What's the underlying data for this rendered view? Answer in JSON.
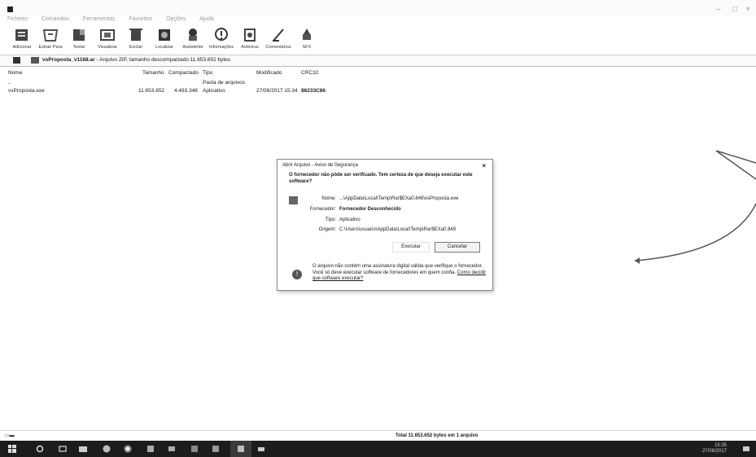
{
  "window": {
    "menu": [
      "Ficheiro",
      "Comandos",
      "Ferramentas",
      "Favoritos",
      "Opções",
      "Ajuda"
    ]
  },
  "toolbar": {
    "buttons": [
      {
        "label": "Adicionar",
        "icon": "add-archive-icon"
      },
      {
        "label": "Extrair Para",
        "icon": "extract-icon"
      },
      {
        "label": "Testar",
        "icon": "test-icon"
      },
      {
        "label": "Visualizar",
        "icon": "view-icon"
      },
      {
        "label": "Excluir",
        "icon": "delete-icon"
      },
      {
        "label": "Localizar",
        "icon": "find-icon"
      },
      {
        "label": "Assistente",
        "icon": "wizard-icon"
      },
      {
        "label": "Informações",
        "icon": "info-icon"
      },
      {
        "label": "Antivírus",
        "icon": "virus-scan-icon"
      },
      {
        "label": "Comentários",
        "icon": "comment-icon"
      },
      {
        "label": "SFX",
        "icon": "sfx-icon"
      }
    ]
  },
  "address": {
    "archive_name": "vsProposta_v1168.ar",
    "info": "- Arquivo ZIP, tamanho descompactado 11.653.652 bytes"
  },
  "columns": {
    "name": "Nome",
    "size": "Tamanho",
    "packed": "Compactado",
    "type": "Tipo",
    "modified": "Modificado",
    "crc": "CRC32"
  },
  "parent_row": {
    "name": "..",
    "type": "Pasta de arquivos"
  },
  "file_row": {
    "name": "vsProposta.exe",
    "size": "11.653.652",
    "packed": "4.493.348",
    "type": "Aplicativo",
    "modified": "27/08/2017 15:34",
    "crc": "86233C86"
  },
  "dialog": {
    "title": "Abrir Arquivo - Aviso de Segurança",
    "close_glyph": "×",
    "question": "O fornecedor não pôde ser verificado. Tem certeza de que deseja executar este software?",
    "name_label": "Nome:",
    "name_value": "...\\AppData\\Local\\Temp\\Rar$EXa0.849\\vsProposta.exe",
    "publisher_label": "Fornecedor:",
    "publisher_value": "Fornecedor Desconhecido",
    "type_label": "Tipo:",
    "type_value": "Aplicativo",
    "origin_label": "Origem:",
    "origin_value": "C:\\Users\\usuario\\AppData\\Local\\Temp\\Rar$EXa0.849",
    "open_button": "Executar",
    "cancel_button": "Cancelar",
    "warning_text": "O arquivo não contém uma assinatura digital válida que verifique o fornecedor. Você só deve executar software de fornecedores em quem confia.",
    "warning_link": "Como decidir que software executar?"
  },
  "status": {
    "left": "",
    "total": "Total 11.653.652 bytes em 1 arquivo"
  },
  "taskbar": {
    "time": "15:35",
    "date": "27/08/2017"
  }
}
